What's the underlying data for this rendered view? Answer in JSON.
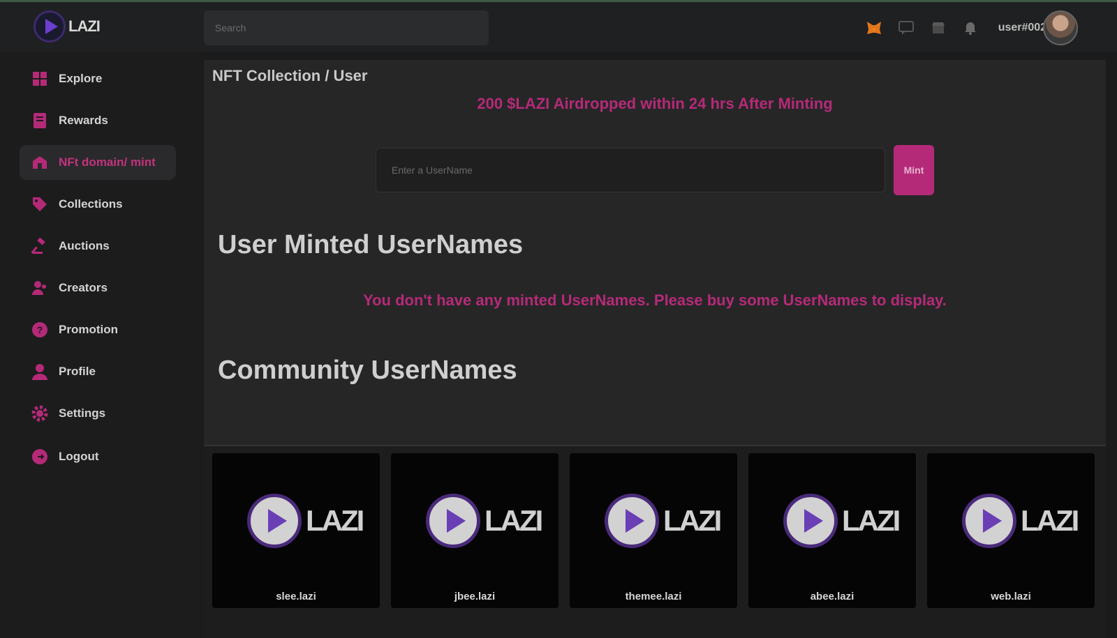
{
  "app": {
    "logo_text": "LAZI",
    "colors": {
      "accent": "#b52a78",
      "brand_purple": "#6b3fd0",
      "background": "#1b1b1c"
    }
  },
  "topbar": {
    "search_placeholder": "Search",
    "icons": [
      "metamask-icon",
      "chat-icon",
      "store-icon",
      "bell-icon"
    ],
    "username": "user#0027"
  },
  "sidebar": {
    "items": [
      {
        "label": "Explore",
        "icon": "explore-icon",
        "active": false
      },
      {
        "label": "Rewards",
        "icon": "rewards-icon",
        "active": false
      },
      {
        "label": "NFt domain/ mint",
        "icon": "domain-icon",
        "active": true
      },
      {
        "label": "Collections",
        "icon": "tag-icon",
        "active": false
      },
      {
        "label": "Auctions",
        "icon": "gavel-icon",
        "active": false
      },
      {
        "label": "Creators",
        "icon": "creators-icon",
        "active": false
      },
      {
        "label": "Promotion",
        "icon": "promotion-icon",
        "active": false
      },
      {
        "label": "Profile",
        "icon": "user-icon",
        "active": false
      },
      {
        "label": "Settings",
        "icon": "gear-icon",
        "active": false
      },
      {
        "label": "Logout",
        "icon": "logout-icon",
        "active": false
      }
    ]
  },
  "main": {
    "breadcrumb": "NFT Collection / User",
    "promo": "200 $LAZI Airdropped within 24 hrs After Minting",
    "mint_placeholder": "Enter a UserName",
    "mint_button": "Mint",
    "user_minted_heading": "User Minted UserNames",
    "empty_message": "You don't have any minted UserNames. Please buy some UserNames to display.",
    "community_heading": "Community UserNames",
    "cards": [
      {
        "brand": "LAZI",
        "name": "slee.lazi"
      },
      {
        "brand": "LAZI",
        "name": "jbee.lazi"
      },
      {
        "brand": "LAZI",
        "name": "themee.lazi"
      },
      {
        "brand": "LAZI",
        "name": "abee.lazi"
      },
      {
        "brand": "LAZI",
        "name": "web.lazi"
      }
    ]
  }
}
